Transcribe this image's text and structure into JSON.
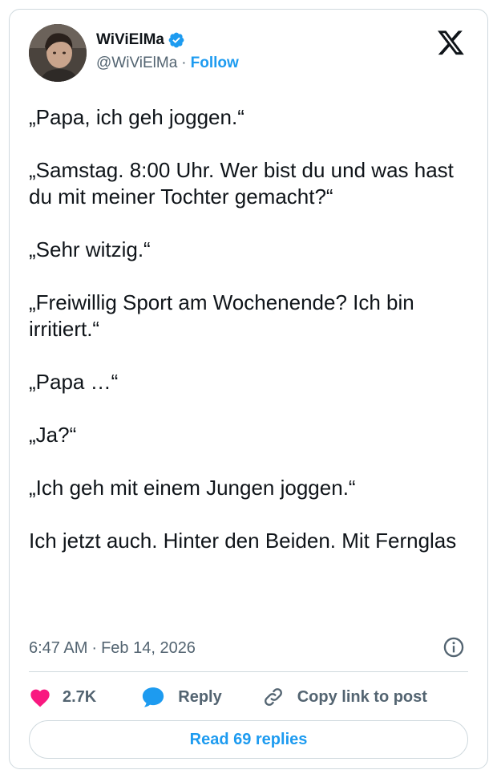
{
  "author": {
    "display_name": "WiViElMa",
    "handle": "@WiViElMa",
    "separator": "·",
    "follow_label": "Follow"
  },
  "tweet": {
    "text": "„Papa, ich geh joggen.“\n\n„Samstag. 8:00 Uhr. Wer bist du und was hast du mit meiner Tochter gemacht?“\n\n„Sehr witzig.“\n\n„Freiwillig Sport am Wochenende? Ich bin irritiert.“\n\n„Papa …“\n\n„Ja?“\n\n„Ich geh mit einem Jungen joggen.“\n\nIch jetzt auch. Hinter den Beiden. Mit Fernglas",
    "time": "6:47 AM",
    "separator": "·",
    "date": "Feb 14, 2026"
  },
  "actions": {
    "like_count": "2.7K",
    "reply_label": "Reply",
    "copy_link_label": "Copy link to post"
  },
  "read_replies_label": "Read 69 replies",
  "colors": {
    "accent": "#1d9bf0",
    "like": "#f91880",
    "text": "#0f1419",
    "muted": "#536471",
    "border": "#cfd9de"
  },
  "icons": [
    "verified-badge-icon",
    "x-logo-icon",
    "info-icon",
    "heart-icon",
    "reply-bubble-icon",
    "link-icon"
  ]
}
